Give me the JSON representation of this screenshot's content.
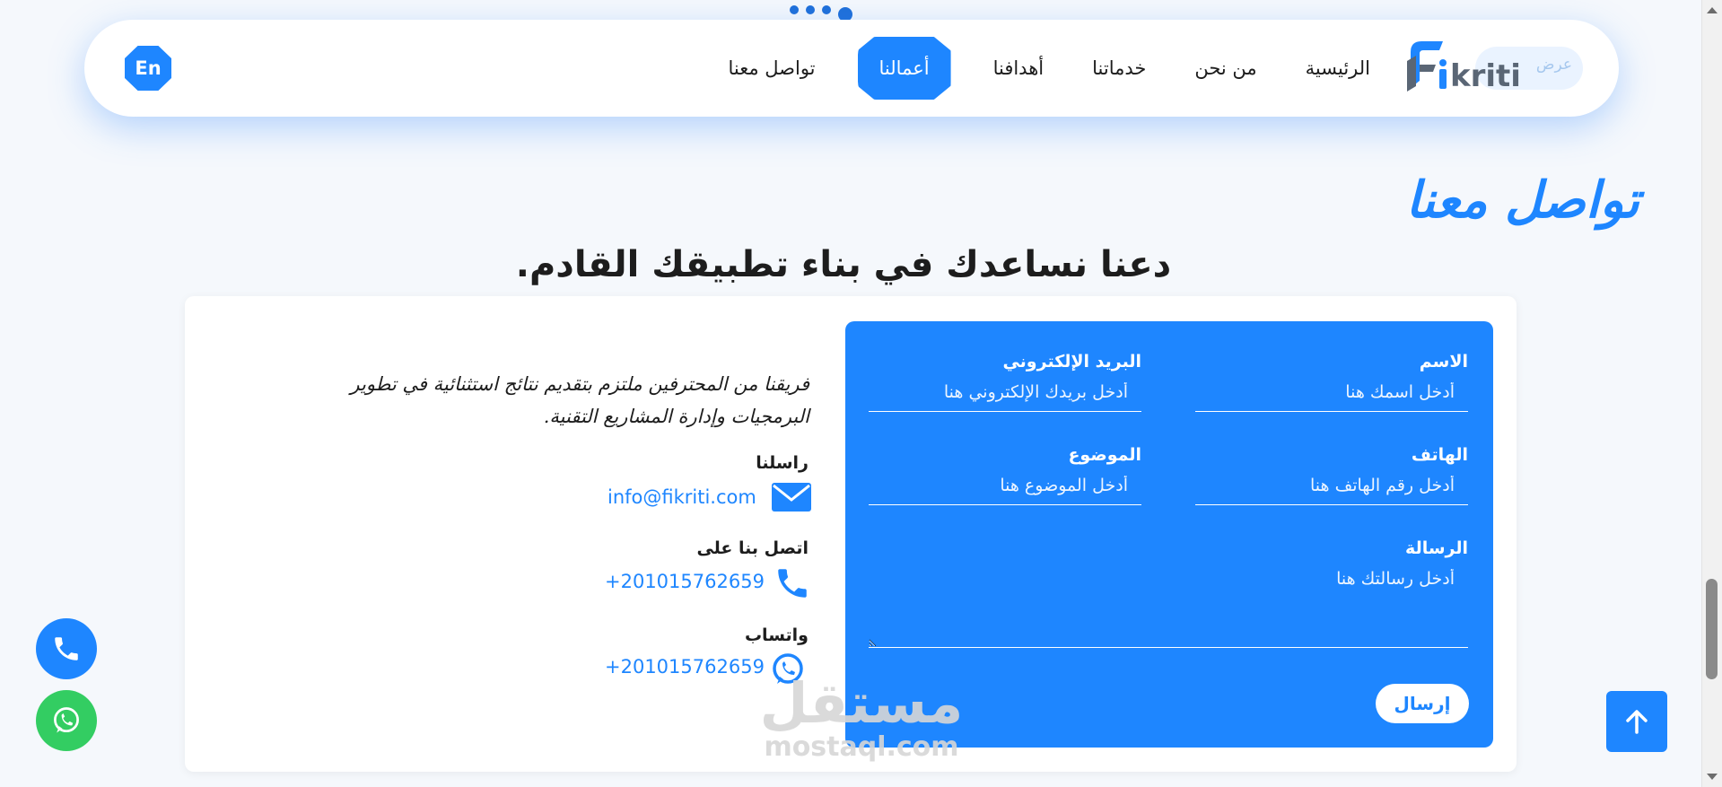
{
  "nav": {
    "links": [
      "الرئيسية",
      "من نحن",
      "خدماتنا",
      "أهدافنا",
      "أعمالنا",
      "تواصل معنا"
    ],
    "active_index": 4,
    "lang_label": "En",
    "logo_text": "fikriti",
    "logo_overlay_text": "عرض"
  },
  "section": {
    "title": "تواصل معنا",
    "subtitle": "دعنا نساعدك في بناء تطبيقك القادم."
  },
  "info": {
    "intro": "فريقنا من المحترفين ملتزم بتقديم نتائج استثنائية في تطوير البرمجيات وإدارة المشاريع التقنية.",
    "email_label": "راسلنا",
    "email": "info@fikriti.com",
    "phone_label": "اتصل بنا على",
    "phone": "+201015762659",
    "whatsapp_label": "واتساب",
    "whatsapp": "+201015762659"
  },
  "form": {
    "name_label": "الاسم",
    "name_placeholder": "أدخل اسمك هنا",
    "email_label": "البريد الإلكتروني",
    "email_placeholder": "أدخل بريدك الإلكتروني هنا",
    "phone_label": "الهاتف",
    "phone_placeholder": "أدخل رقم الهاتف هنا",
    "subject_label": "الموضوع",
    "subject_placeholder": "أدخل الموضوع هنا",
    "message_label": "الرسالة",
    "message_placeholder": "أدخل رسالتك هنا",
    "submit_label": "إرسال"
  },
  "watermark": {
    "arabic": "مستقل",
    "latin": "mostaql.com"
  },
  "colors": {
    "accent": "#1e86ff",
    "whatsapp": "#33cd62",
    "background": "#f5f8fc"
  },
  "icons": {
    "email": "envelope-icon",
    "phone": "phone-icon",
    "whatsapp": "whatsapp-icon",
    "scroll_top": "arrow-up-icon"
  }
}
